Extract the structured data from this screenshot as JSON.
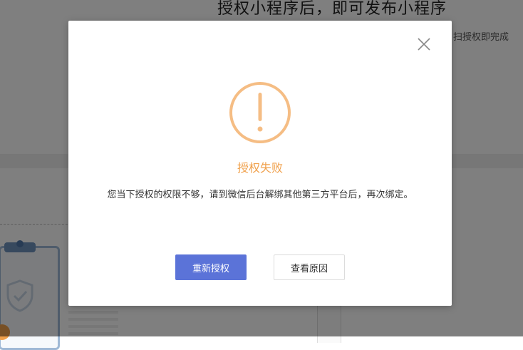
{
  "background": {
    "title": "授权小程序后，即可发布小程序",
    "subtext": "扫授权即完成"
  },
  "modal": {
    "icon": "warning-circle-icon",
    "title": "授权失败",
    "message": "您当下授权的权限不够，请到微信后台解绑其他第三方平台后，再次绑定。",
    "primary_button": "重新授权",
    "secondary_button": "查看原因",
    "close_icon": "close-icon"
  },
  "colors": {
    "accent_orange": "#f0a04b",
    "warning_ring": "#f5bd84",
    "primary_button": "#5b73d8",
    "overlay": "rgba(0,0,0,0.5)"
  }
}
